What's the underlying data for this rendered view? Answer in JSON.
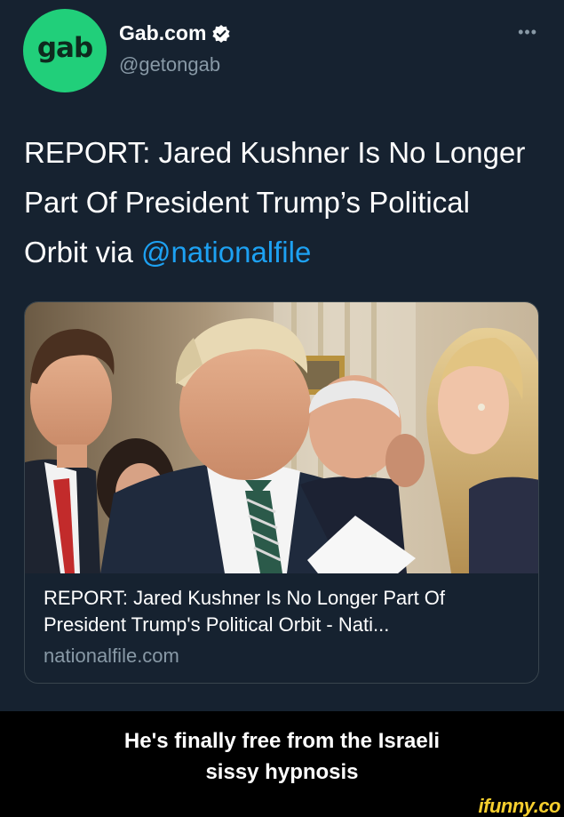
{
  "account": {
    "avatar_text": "gab",
    "display_name": "Gab.com",
    "handle": "@getongab",
    "more_label": "•••",
    "avatar_color": "#21cf7a"
  },
  "tweet": {
    "text_main": "REPORT: Jared Kushner Is No Longer Part Of President Trump’s Political Orbit via ",
    "mention": "@nationalfile"
  },
  "card": {
    "title": "REPORT: Jared Kushner Is No Longer Part Of President Trump's Political Orbit - Nati...",
    "domain": "nationalfile.com"
  },
  "caption": {
    "line1": "He's finally free from the Israeli",
    "line2": "sissy hypnosis"
  },
  "watermark": "ifunny.co",
  "colors": {
    "background": "#15202b",
    "link": "#1da1f2",
    "secondary_text": "#8899a6",
    "watermark": "#f7cf2e"
  }
}
